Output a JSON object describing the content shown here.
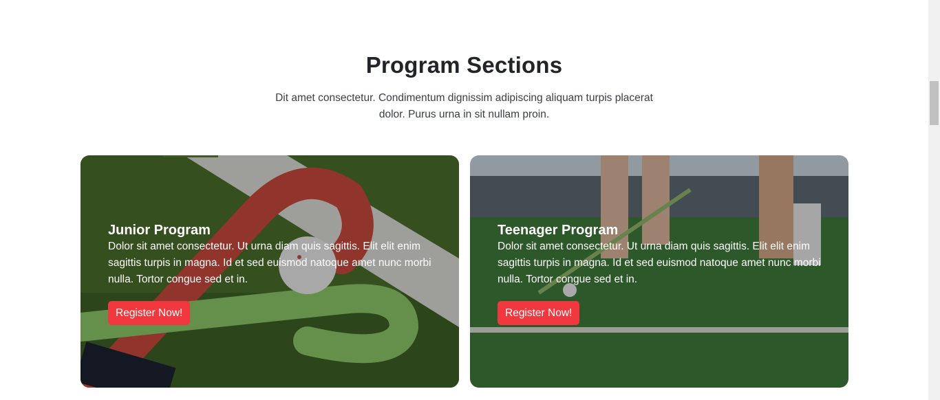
{
  "section": {
    "title": "Program Sections",
    "description": "Dit amet consectetur. Condimentum dignissim adipiscing aliquam turpis placerat dolor. Purus urna in sit nullam proin."
  },
  "cards": [
    {
      "title": "Junior Program",
      "text": "Dolor sit amet consectetur. Ut urna diam quis sagittis. Elit elit enim sagittis turpis in magna. Id et sed euismod natoque amet nunc morbi nulla. Tortor congue sed et in.",
      "button_label": "Register Now!",
      "image": "hockey-stick-and-ball"
    },
    {
      "title": "Teenager Program",
      "text": "Dolor sit amet consectetur. Ut urna diam quis sagittis. Elit elit enim sagittis turpis in magna. Id et sed euismod natoque amet nunc morbi nulla. Tortor congue sed et in.",
      "button_label": "Register Now!",
      "image": "hockey-players-on-field"
    }
  ],
  "colors": {
    "accent": "#f0383e",
    "heading": "#212529",
    "turf": "#3f6b2a"
  }
}
